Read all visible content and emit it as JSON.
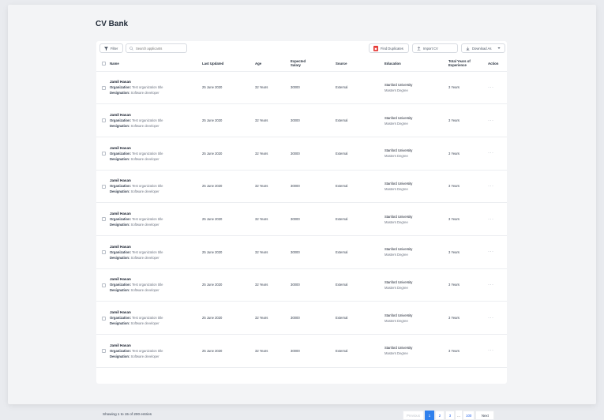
{
  "page": {
    "title": "CV Bank"
  },
  "toolbar": {
    "filter_label": "Filter",
    "search_placeholder": "Search applicants",
    "find_duplicates_label": "Find Duplicates",
    "import_label": "Import CV",
    "download_label": "Download As"
  },
  "table": {
    "headers": {
      "name": "Name",
      "last_updated": "Last Updated",
      "age": "Age",
      "expected_salary_line1": "Expected",
      "expected_salary_line2": "Salary",
      "source": "Source",
      "education": "Education",
      "experience_line1": "Total Years of",
      "experience_line2": "Experience",
      "action": "Action"
    },
    "org_label": "Organization:",
    "designation_label": "Designation:",
    "rows": [
      {
        "name": "Jamil Hasan",
        "organization": "Test organization title",
        "designation": "Software developer",
        "last_updated": "25 June 2020",
        "age": "32 Years",
        "salary": "30000",
        "source": "External",
        "school": "Stanford University",
        "degree": "Masters Degree",
        "experience": "3 Years",
        "action": "···"
      },
      {
        "name": "Jamil Hasan",
        "organization": "Test organization title",
        "designation": "Software developer",
        "last_updated": "25 June 2020",
        "age": "32 Years",
        "salary": "30000",
        "source": "External",
        "school": "Stanford University",
        "degree": "Masters Degree",
        "experience": "3 Years",
        "action": "···"
      },
      {
        "name": "Jamil Hasan",
        "organization": "Test organization title",
        "designation": "Software developer",
        "last_updated": "25 June 2020",
        "age": "32 Years",
        "salary": "30000",
        "source": "External",
        "school": "Stanford University",
        "degree": "Masters Degree",
        "experience": "3 Years",
        "action": "···"
      },
      {
        "name": "Jamil Hasan",
        "organization": "Test organization title",
        "designation": "Software developer",
        "last_updated": "25 June 2020",
        "age": "32 Years",
        "salary": "30000",
        "source": "External",
        "school": "Stanford University",
        "degree": "Masters Degree",
        "experience": "3 Years",
        "action": "···"
      },
      {
        "name": "Jamil Hasan",
        "organization": "Test organization title",
        "designation": "Software developer",
        "last_updated": "25 June 2020",
        "age": "32 Years",
        "salary": "30000",
        "source": "External",
        "school": "Stanford University",
        "degree": "Masters Degree",
        "experience": "3 Years",
        "action": "···"
      },
      {
        "name": "Jamil Hasan",
        "organization": "Test organization title",
        "designation": "Software developer",
        "last_updated": "25 June 2020",
        "age": "32 Years",
        "salary": "30000",
        "source": "External",
        "school": "Stanford University",
        "degree": "Masters Degree",
        "experience": "3 Years",
        "action": "···"
      },
      {
        "name": "Jamil Hasan",
        "organization": "Test organization title",
        "designation": "Software developer",
        "last_updated": "25 June 2020",
        "age": "32 Years",
        "salary": "30000",
        "source": "External",
        "school": "Stanford University",
        "degree": "Masters Degree",
        "experience": "3 Years",
        "action": "···"
      },
      {
        "name": "Jamil Hasan",
        "organization": "Test organization title",
        "designation": "Software developer",
        "last_updated": "25 June 2020",
        "age": "32 Years",
        "salary": "30000",
        "source": "External",
        "school": "Stanford University",
        "degree": "Masters Degree",
        "experience": "3 Years",
        "action": "···"
      },
      {
        "name": "Jamil Hasan",
        "organization": "Test organization title",
        "designation": "Software developer",
        "last_updated": "25 June 2020",
        "age": "32 Years",
        "salary": "30000",
        "source": "External",
        "school": "Stanford University",
        "degree": "Masters Degree",
        "experience": "3 Years",
        "action": "···"
      }
    ]
  },
  "footer": {
    "entries_text": "Showing 1 to 15 of 200 entries"
  },
  "pagination": {
    "prev_label": "Previous",
    "pages": [
      "1",
      "2",
      "3"
    ],
    "ellipsis": "...",
    "last_page": "100",
    "next_label": "Next",
    "active_page": "1"
  },
  "colors": {
    "accent": "#2f80ed",
    "duplicate_icon": "#e53935"
  },
  "icons": {
    "filter": "filter-icon",
    "search": "search-icon",
    "duplicate": "duplicate-icon",
    "import": "upload-icon",
    "download": "download-icon",
    "dropdown": "chevron-down-icon",
    "action": "more-horizontal-icon"
  }
}
